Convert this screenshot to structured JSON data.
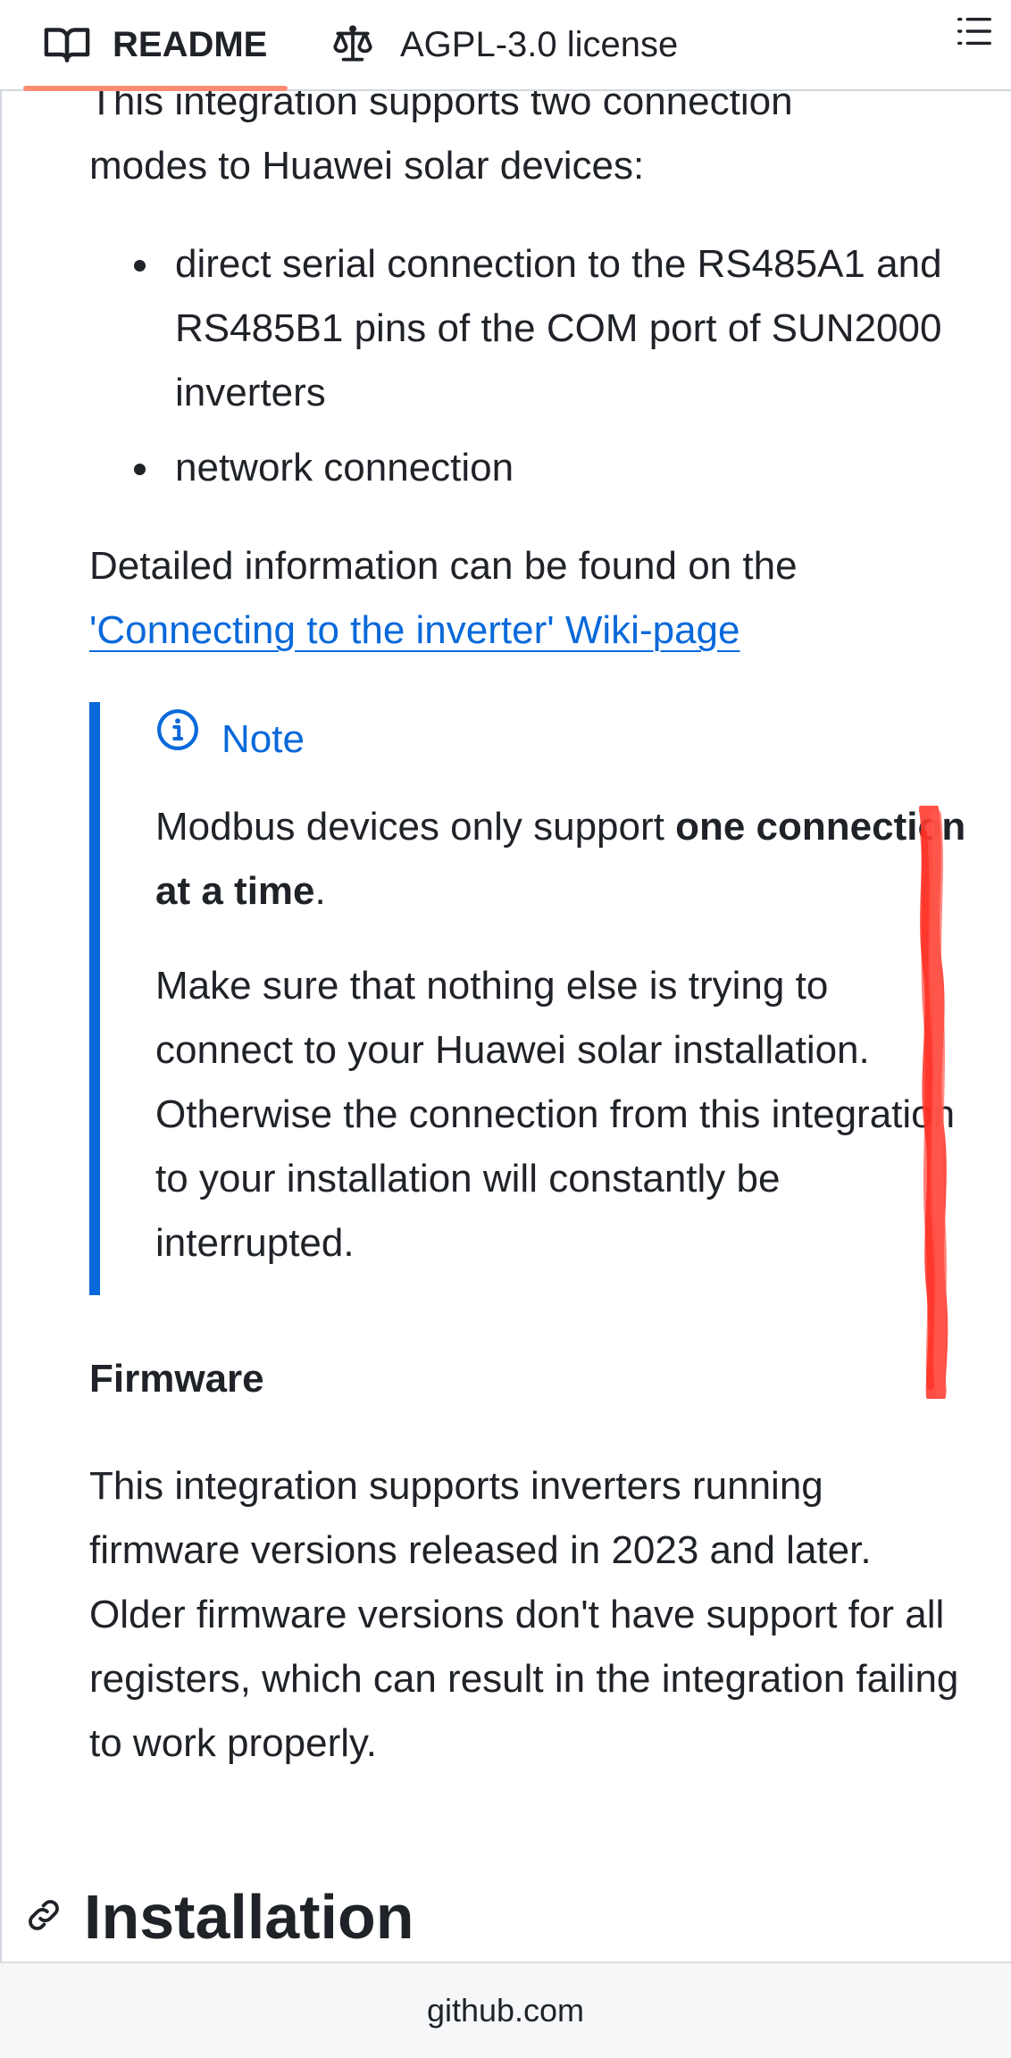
{
  "tabs": {
    "readme_label": "README",
    "license_label": "AGPL-3.0 license"
  },
  "intro": {
    "partial_line": "This integration supports two connection",
    "line2": "modes to Huawei solar devices:"
  },
  "modes": [
    "direct serial connection to the RS485A1 and RS485B1 pins of the COM port of SUN2000 inverters",
    "network connection"
  ],
  "detail": {
    "text": "Detailed information can be found on the",
    "link": "'Connecting to the inverter' Wiki-page"
  },
  "note": {
    "title": "Note",
    "p1_prefix": "Modbus devices only support ",
    "p1_bold": "one connection at a time",
    "p1_suffix": ".",
    "p2": "Make sure that nothing else is trying to connect to your Huawei solar installation. Otherwise the connection from this integration to your installation will constantly be interrupted."
  },
  "firmware": {
    "heading": "Firmware",
    "text": "This integration supports inverters running firmware versions released in 2023 and later. Older firmware versions don't have support for all registers, which can result in the integration failing to work properly."
  },
  "installation": {
    "heading": "Installation"
  },
  "footer": {
    "domain": "github.com"
  },
  "colors": {
    "link": "#0969da",
    "tab_underline": "#fd8c73",
    "scribble": "#ff3b30"
  }
}
